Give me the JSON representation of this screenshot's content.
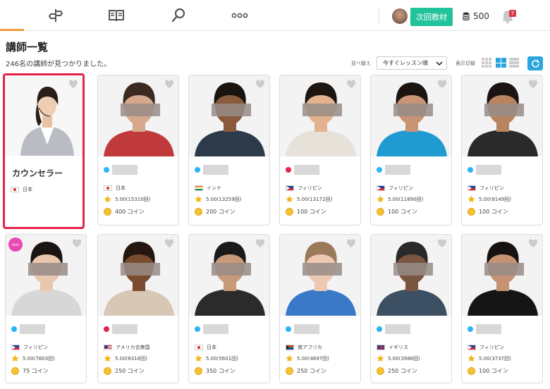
{
  "nav": {
    "next_material_label": "次回教材",
    "coin_balance": "500",
    "notification_count": "7"
  },
  "page": {
    "title": "講師一覧",
    "result_count": "246名の講師が見つかりました。",
    "sort_label": "並べ替え",
    "sort_value": "今すぐレッスン順",
    "view_label": "表示切替"
  },
  "colors": {
    "accent_orange": "#f29a3b",
    "primary_green": "#22c29a",
    "online_blue": "#29b6f6",
    "busy_red": "#e5234d",
    "highlight_red": "#e5234d"
  },
  "counselor": {
    "name": "カウンセラー",
    "country": "日本"
  },
  "new_badge": "NEW",
  "tutors": [
    {
      "country": "日本",
      "rating": "5.00(15310回)",
      "coins": "400 コイン",
      "status": "online",
      "flag": "jp"
    },
    {
      "country": "インド",
      "rating": "5.00(13259回)",
      "coins": "200 コイン",
      "status": "online",
      "flag": "in"
    },
    {
      "country": "フィリピン",
      "rating": "5.00(13172回)",
      "coins": "100 コイン",
      "status": "busy",
      "flag": "ph"
    },
    {
      "country": "フィリピン",
      "rating": "5.00(11890回)",
      "coins": "100 コイン",
      "status": "online",
      "flag": "ph"
    },
    {
      "country": "フィリピン",
      "rating": "5.00(8149回)",
      "coins": "100 コイン",
      "status": "online",
      "flag": "ph"
    },
    {
      "country": "フィリピン",
      "rating": "5.00(7803回)",
      "coins": "75 コイン",
      "status": "online",
      "flag": "ph"
    },
    {
      "country": "アメリカ合衆国",
      "rating": "5.00(6318回)",
      "coins": "250 コイン",
      "status": "busy",
      "flag": "us"
    },
    {
      "country": "日本",
      "rating": "5.00(5601回)",
      "coins": "350 コイン",
      "status": "online",
      "flag": "jp"
    },
    {
      "country": "南アフリカ",
      "rating": "5.00(4697回)",
      "coins": "250 コイン",
      "status": "online",
      "flag": "za"
    },
    {
      "country": "イギリス",
      "rating": "5.00(3986回)",
      "coins": "250 コイン",
      "status": "online",
      "flag": "gb"
    },
    {
      "country": "フィリピン",
      "rating": "5.00(3737回)",
      "coins": "100 コイン",
      "status": "online",
      "flag": "ph"
    }
  ]
}
